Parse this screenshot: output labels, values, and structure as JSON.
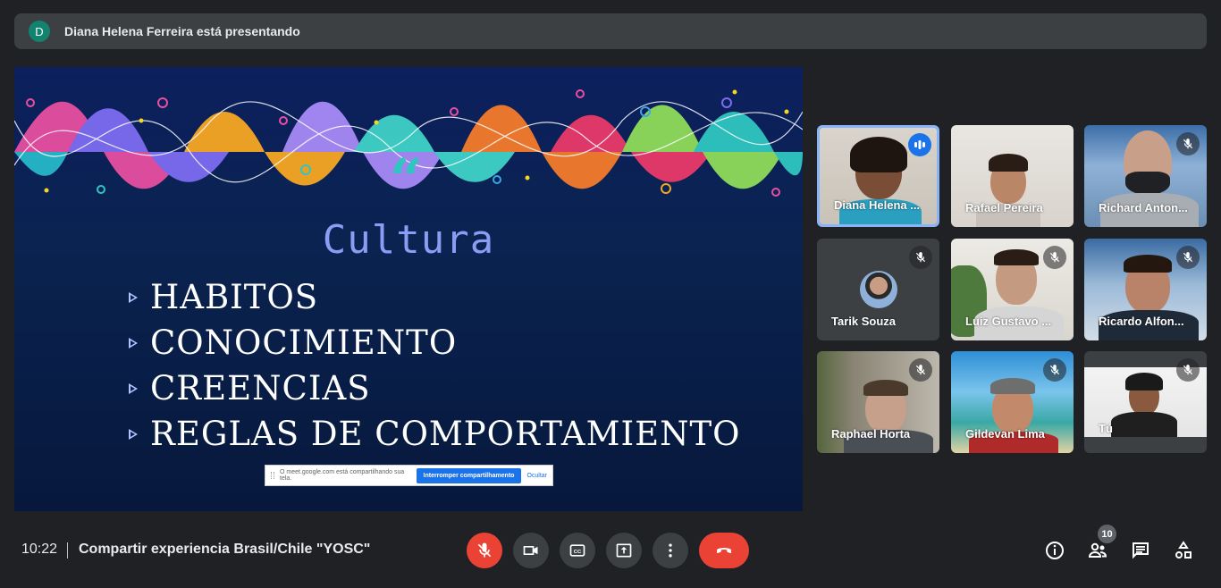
{
  "banner": {
    "avatar_letter": "D",
    "text": "Diana Helena Ferreira está presentando"
  },
  "slide": {
    "quote_mark": "“",
    "title": "Cultura",
    "items": [
      "HABITOS",
      "CONOCIMIENTO",
      "CREENCIAS",
      "REGLAS DE COMPORTAMIENTO"
    ]
  },
  "share_bar": {
    "message": "O meet.google.com está compartilhando sua tela.",
    "stop_label": "Interromper compartilhamento",
    "hide_label": "Ocultar"
  },
  "participants": [
    {
      "name": "Diana Helena ...",
      "speaking": true
    },
    {
      "name": "Rafael Pereira",
      "muted": false
    },
    {
      "name": "Richard Anton...",
      "muted": true
    },
    {
      "name": "Tarik Souza",
      "muted": true
    },
    {
      "name": "Luiz Gustavo ...",
      "muted": true
    },
    {
      "name": "Ricardo Alfon...",
      "muted": true
    },
    {
      "name": "Raphael Horta",
      "muted": true
    },
    {
      "name": "Gildevan Lima",
      "muted": true
    },
    {
      "name": "Tú",
      "muted": true
    }
  ],
  "bottom_bar": {
    "time": "10:22",
    "meeting_title": "Compartir experiencia Brasil/Chile \"YOSC\"",
    "participant_count": "10"
  },
  "icons": {
    "mic_off": "mic-off-icon",
    "camera": "videocam-icon",
    "captions": "closed-caption-icon",
    "present": "present-to-all-icon",
    "more": "more-vert-icon",
    "hangup": "call-end-icon",
    "info": "info-icon",
    "people": "people-icon",
    "chat": "chat-icon",
    "activities": "activities-icon"
  },
  "colors": {
    "background": "#202124",
    "accent_red": "#ea4335",
    "speaking_blue": "#1a73e8",
    "active_border": "#8ab4f8"
  }
}
